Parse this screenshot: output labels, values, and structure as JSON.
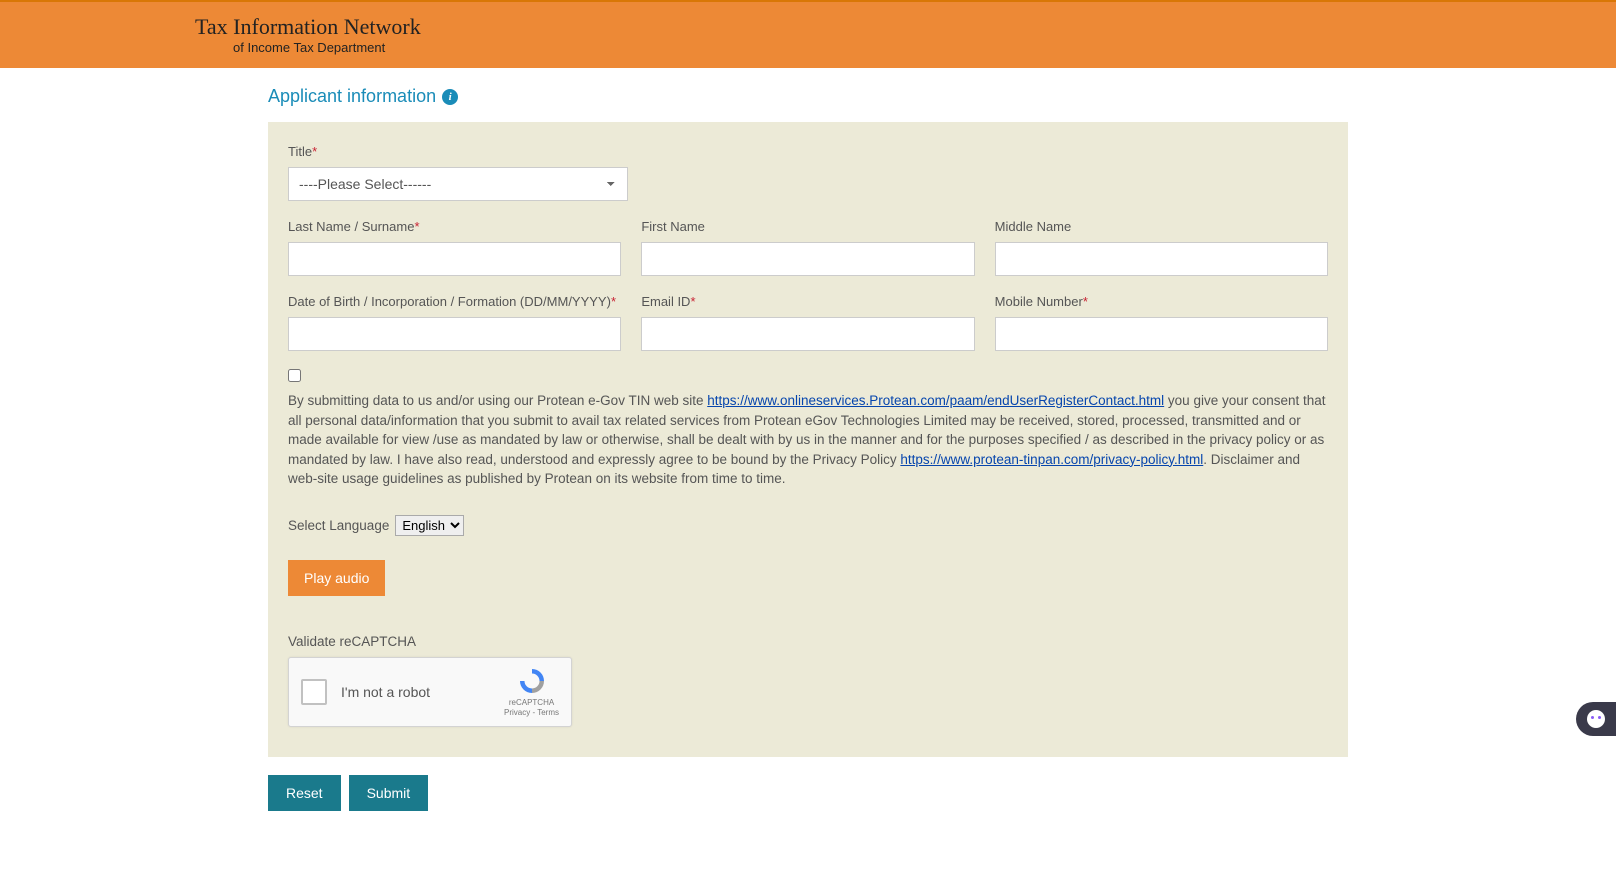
{
  "header": {
    "title": "Tax Information Network",
    "subtitle": "of Income Tax Department"
  },
  "section": {
    "title": "Applicant information"
  },
  "form": {
    "title_label": "Title",
    "title_placeholder": "----Please Select------",
    "lastname_label": "Last Name / Surname",
    "firstname_label": "First Name",
    "middlename_label": "Middle Name",
    "dob_label": "Date of Birth / Incorporation / Formation (DD/MM/YYYY)",
    "email_label": "Email ID",
    "mobile_label": "Mobile Number"
  },
  "consent": {
    "pre": "By submitting data to us and/or using our Protean e-Gov TIN web site ",
    "link1": "https://www.onlineservices.Protean.com/paam/endUserRegisterContact.html",
    "mid": " you give your consent that all personal data/information that you submit to avail tax related services from Protean eGov Technologies Limited may be received, stored, processed, transmitted and or made available for view /use as mandated by law or otherwise, shall be dealt with by us in the manner and for the purposes specified / as described in the privacy policy or as mandated by law. I have also read, understood and expressly agree to be bound by the Privacy Policy ",
    "link2": "https://www.protean-tinpan.com/privacy-policy.html",
    "post": ". Disclaimer and web-site usage guidelines as published by Protean on its website from time to time."
  },
  "language": {
    "label": "Select Language",
    "selected": "English"
  },
  "audio": {
    "button": "Play audio"
  },
  "captcha": {
    "label": "Validate reCAPTCHA",
    "text": "I'm not a robot",
    "brand": "reCAPTCHA",
    "links": "Privacy - Terms"
  },
  "buttons": {
    "reset": "Reset",
    "submit": "Submit"
  }
}
